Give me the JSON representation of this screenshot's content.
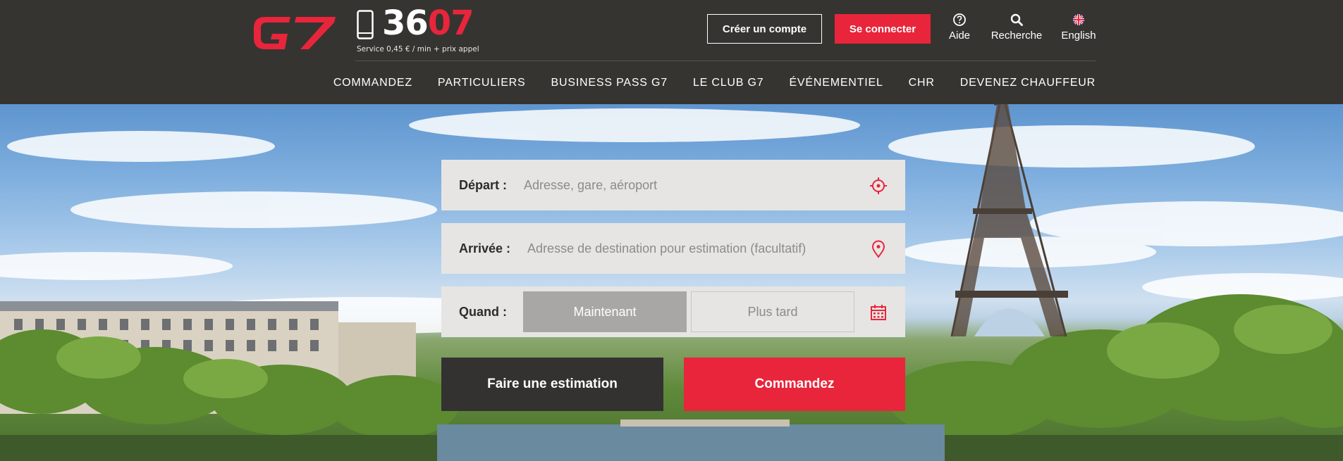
{
  "brand": {
    "logo": "G7",
    "accent_color": "#e8253b"
  },
  "phone": {
    "number_white": "36",
    "number_red": "07",
    "subtext": "Service 0,45 € / min + prix appel",
    "icon": "mobile-phone-icon"
  },
  "header": {
    "create_account": "Créer un compte",
    "login": "Se connecter",
    "help": "Aide",
    "search": "Recherche",
    "language": "English"
  },
  "nav": {
    "items": [
      "COMMANDEZ",
      "PARTICULIERS",
      "BUSINESS PASS G7",
      "LE CLUB G7",
      "ÉVÉNEMENTIEL",
      "CHR",
      "DEVENEZ CHAUFFEUR"
    ]
  },
  "form": {
    "depart_label": "Départ :",
    "depart_placeholder": "Adresse, gare, aéroport",
    "arrivee_label": "Arrivée :",
    "arrivee_placeholder": "Adresse de destination pour estimation (facultatif)",
    "quand_label": "Quand :",
    "now": "Maintenant",
    "later": "Plus tard",
    "estimate_button": "Faire une estimation",
    "order_button": "Commandez"
  }
}
